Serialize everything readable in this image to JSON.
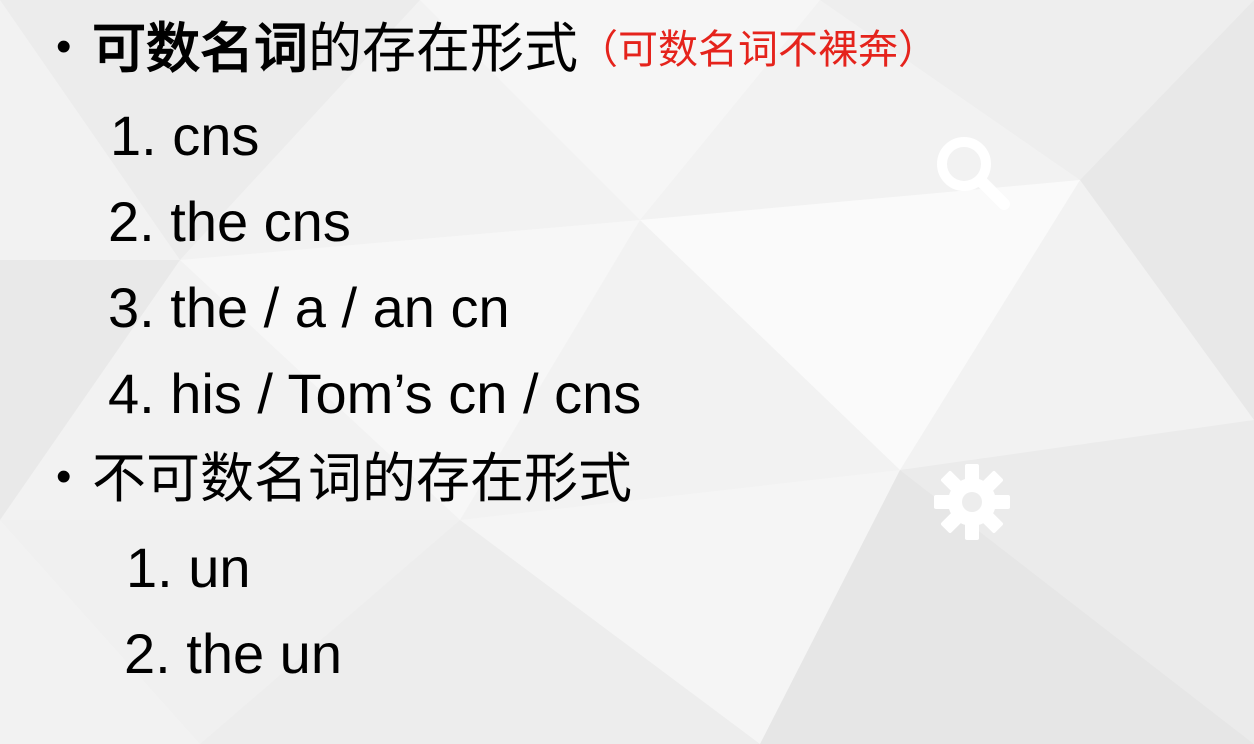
{
  "colors": {
    "background": "#f3f3f3",
    "text": "#000000",
    "note": "#e5231c",
    "icon": "#ffffff"
  },
  "sections": [
    {
      "bullet": "•",
      "heading_bold": "可数名词",
      "heading_rest": "的存在形式",
      "note": "（可数名词不裸奔）",
      "items": [
        "1. cns",
        "2. the cns",
        "3. the / a / an cn",
        "4. his / Tom’s cn / cns"
      ]
    },
    {
      "bullet": "•",
      "heading_bold": "不可数名词",
      "heading_rest": "的存在形式",
      "items": [
        "1. un",
        "2. the un"
      ]
    }
  ],
  "icons": [
    "search-icon",
    "gear-icon"
  ]
}
